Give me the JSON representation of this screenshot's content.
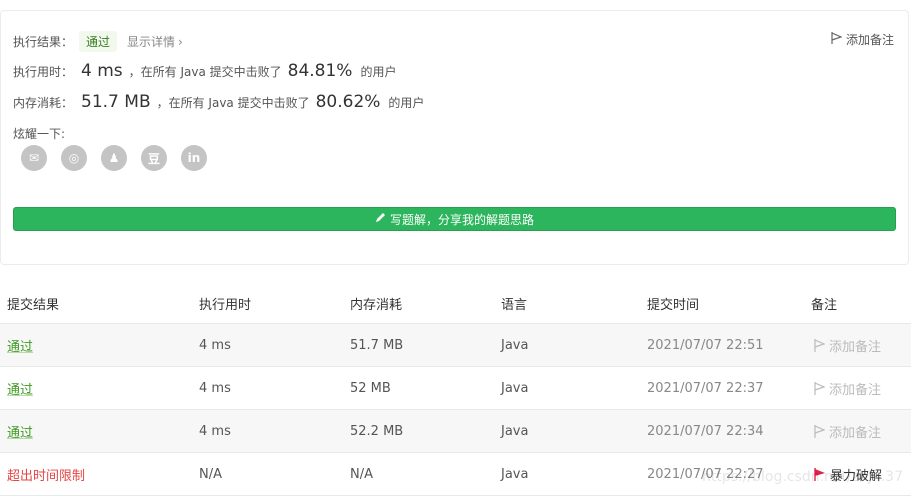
{
  "summary": {
    "result_label": "执行结果：",
    "result_badge": "通过",
    "details_link": "显示详情",
    "add_note": "添加备注",
    "runtime_label": "执行用时：",
    "runtime_value": "4 ms",
    "runtime_mid": "，在所有 Java 提交中击败了",
    "runtime_pct": "84.81%",
    "runtime_suffix": "的用户",
    "memory_label": "内存消耗：",
    "memory_value": "51.7 MB",
    "memory_mid": "，在所有 Java 提交中击败了",
    "memory_pct": "80.62%",
    "memory_suffix": "的用户",
    "share_label": "炫耀一下:",
    "share_icons": [
      "wechat-icon",
      "weibo-icon",
      "qq-icon",
      "douban-icon",
      "linkedin-icon"
    ],
    "share_glyphs": [
      "✉",
      "◎",
      "♟",
      "豆",
      "in"
    ],
    "write_button": "写题解，分享我的解题思路"
  },
  "table": {
    "headers": [
      "提交结果",
      "执行用时",
      "内存消耗",
      "语言",
      "提交时间",
      "备注"
    ],
    "rows": [
      {
        "status": "通过",
        "time": "4 ms",
        "memory": "51.7 MB",
        "lang": "Java",
        "submitted": "2021/07/07 22:51",
        "note": "添加备注"
      },
      {
        "status": "通过",
        "time": "4 ms",
        "memory": "52 MB",
        "lang": "Java",
        "submitted": "2021/07/07 22:37",
        "note": "添加备注"
      },
      {
        "status": "通过",
        "time": "4 ms",
        "memory": "52.2 MB",
        "lang": "Java",
        "submitted": "2021/07/07 22:34",
        "note": "添加备注"
      },
      {
        "status": "超出时间限制",
        "time": "N/A",
        "memory": "N/A",
        "lang": "Java",
        "submitted": "2021/07/07 22:27",
        "note": "暴力破解"
      }
    ]
  },
  "watermark": "https://blog.csdn.net/zhj...37",
  "colors": {
    "accent": "#2db55d",
    "pass": "#3c9a1f",
    "fail": "#e54545"
  }
}
